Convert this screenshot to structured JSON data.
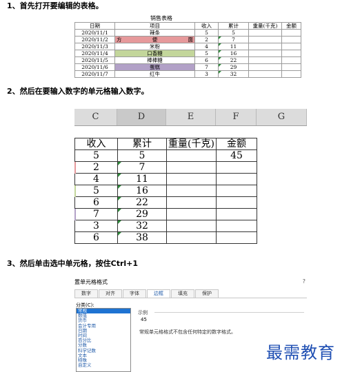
{
  "steps": {
    "s1": "1、首先打开要编辑的表格。",
    "s2": "2、然后在要输入数字的单元格输入数字。",
    "s3": "3、然后单击选中单元格，按住Ctrl+1"
  },
  "sheet1": {
    "title": "销售表格",
    "headers": [
      "日期",
      "项目",
      "收入",
      "累计",
      "重量(千克)",
      "金额"
    ],
    "rows": [
      {
        "date": "2020/11/1",
        "item": "辣条",
        "income": "5",
        "total": "5"
      },
      {
        "date": "2020/11/2",
        "item_left": "方",
        "item_mid": "便",
        "item_right": "面",
        "income": "2",
        "total": "7"
      },
      {
        "date": "2020/11/3",
        "item": "米粉",
        "income": "4",
        "total": "11"
      },
      {
        "date": "2020/11/4",
        "item": "口香糖",
        "income": "5",
        "total": "16"
      },
      {
        "date": "2020/11/5",
        "item": "棒棒糖",
        "income": "6",
        "total": "22"
      },
      {
        "date": "2020/11/6",
        "item": "蛋糕",
        "income": "7",
        "total": "29"
      },
      {
        "date": "2020/11/7",
        "item": "红牛",
        "income": "3",
        "total": "32"
      }
    ]
  },
  "sheet2": {
    "columns": [
      "C",
      "D",
      "E",
      "F",
      "G"
    ],
    "headers": [
      "收入",
      "累计",
      "重量(千克)",
      "金额"
    ],
    "rows": [
      [
        "5",
        "5",
        "",
        "45"
      ],
      [
        "2",
        "7",
        "",
        ""
      ],
      [
        "4",
        "11",
        "",
        ""
      ],
      [
        "5",
        "16",
        "",
        ""
      ],
      [
        "6",
        "22",
        "",
        ""
      ],
      [
        "7",
        "29",
        "",
        ""
      ],
      [
        "3",
        "32",
        "",
        ""
      ],
      [
        "6",
        "38",
        "",
        ""
      ]
    ]
  },
  "dialog": {
    "title": "置单元格格式",
    "help": "?",
    "tabs": [
      "数字",
      "对齐",
      "字体",
      "边框",
      "填充",
      "保护"
    ],
    "category_label": "分类(C):",
    "categories": [
      "常规",
      "数值",
      "货币",
      "会计专用",
      "日期",
      "时间",
      "百分比",
      "分数",
      "科学记数",
      "文本",
      "特殊",
      "自定义"
    ],
    "sample_label": "示例",
    "sample_value": "45",
    "description": "常规单元格格式不包含任何特定的数字格式。"
  },
  "watermark": "最需教育",
  "colors": {
    "pink": "#e6999b",
    "green": "#c3d69b",
    "purple": "#b2a1c7",
    "watermark": "#1f4fb3",
    "selected": "#1e73d2"
  }
}
